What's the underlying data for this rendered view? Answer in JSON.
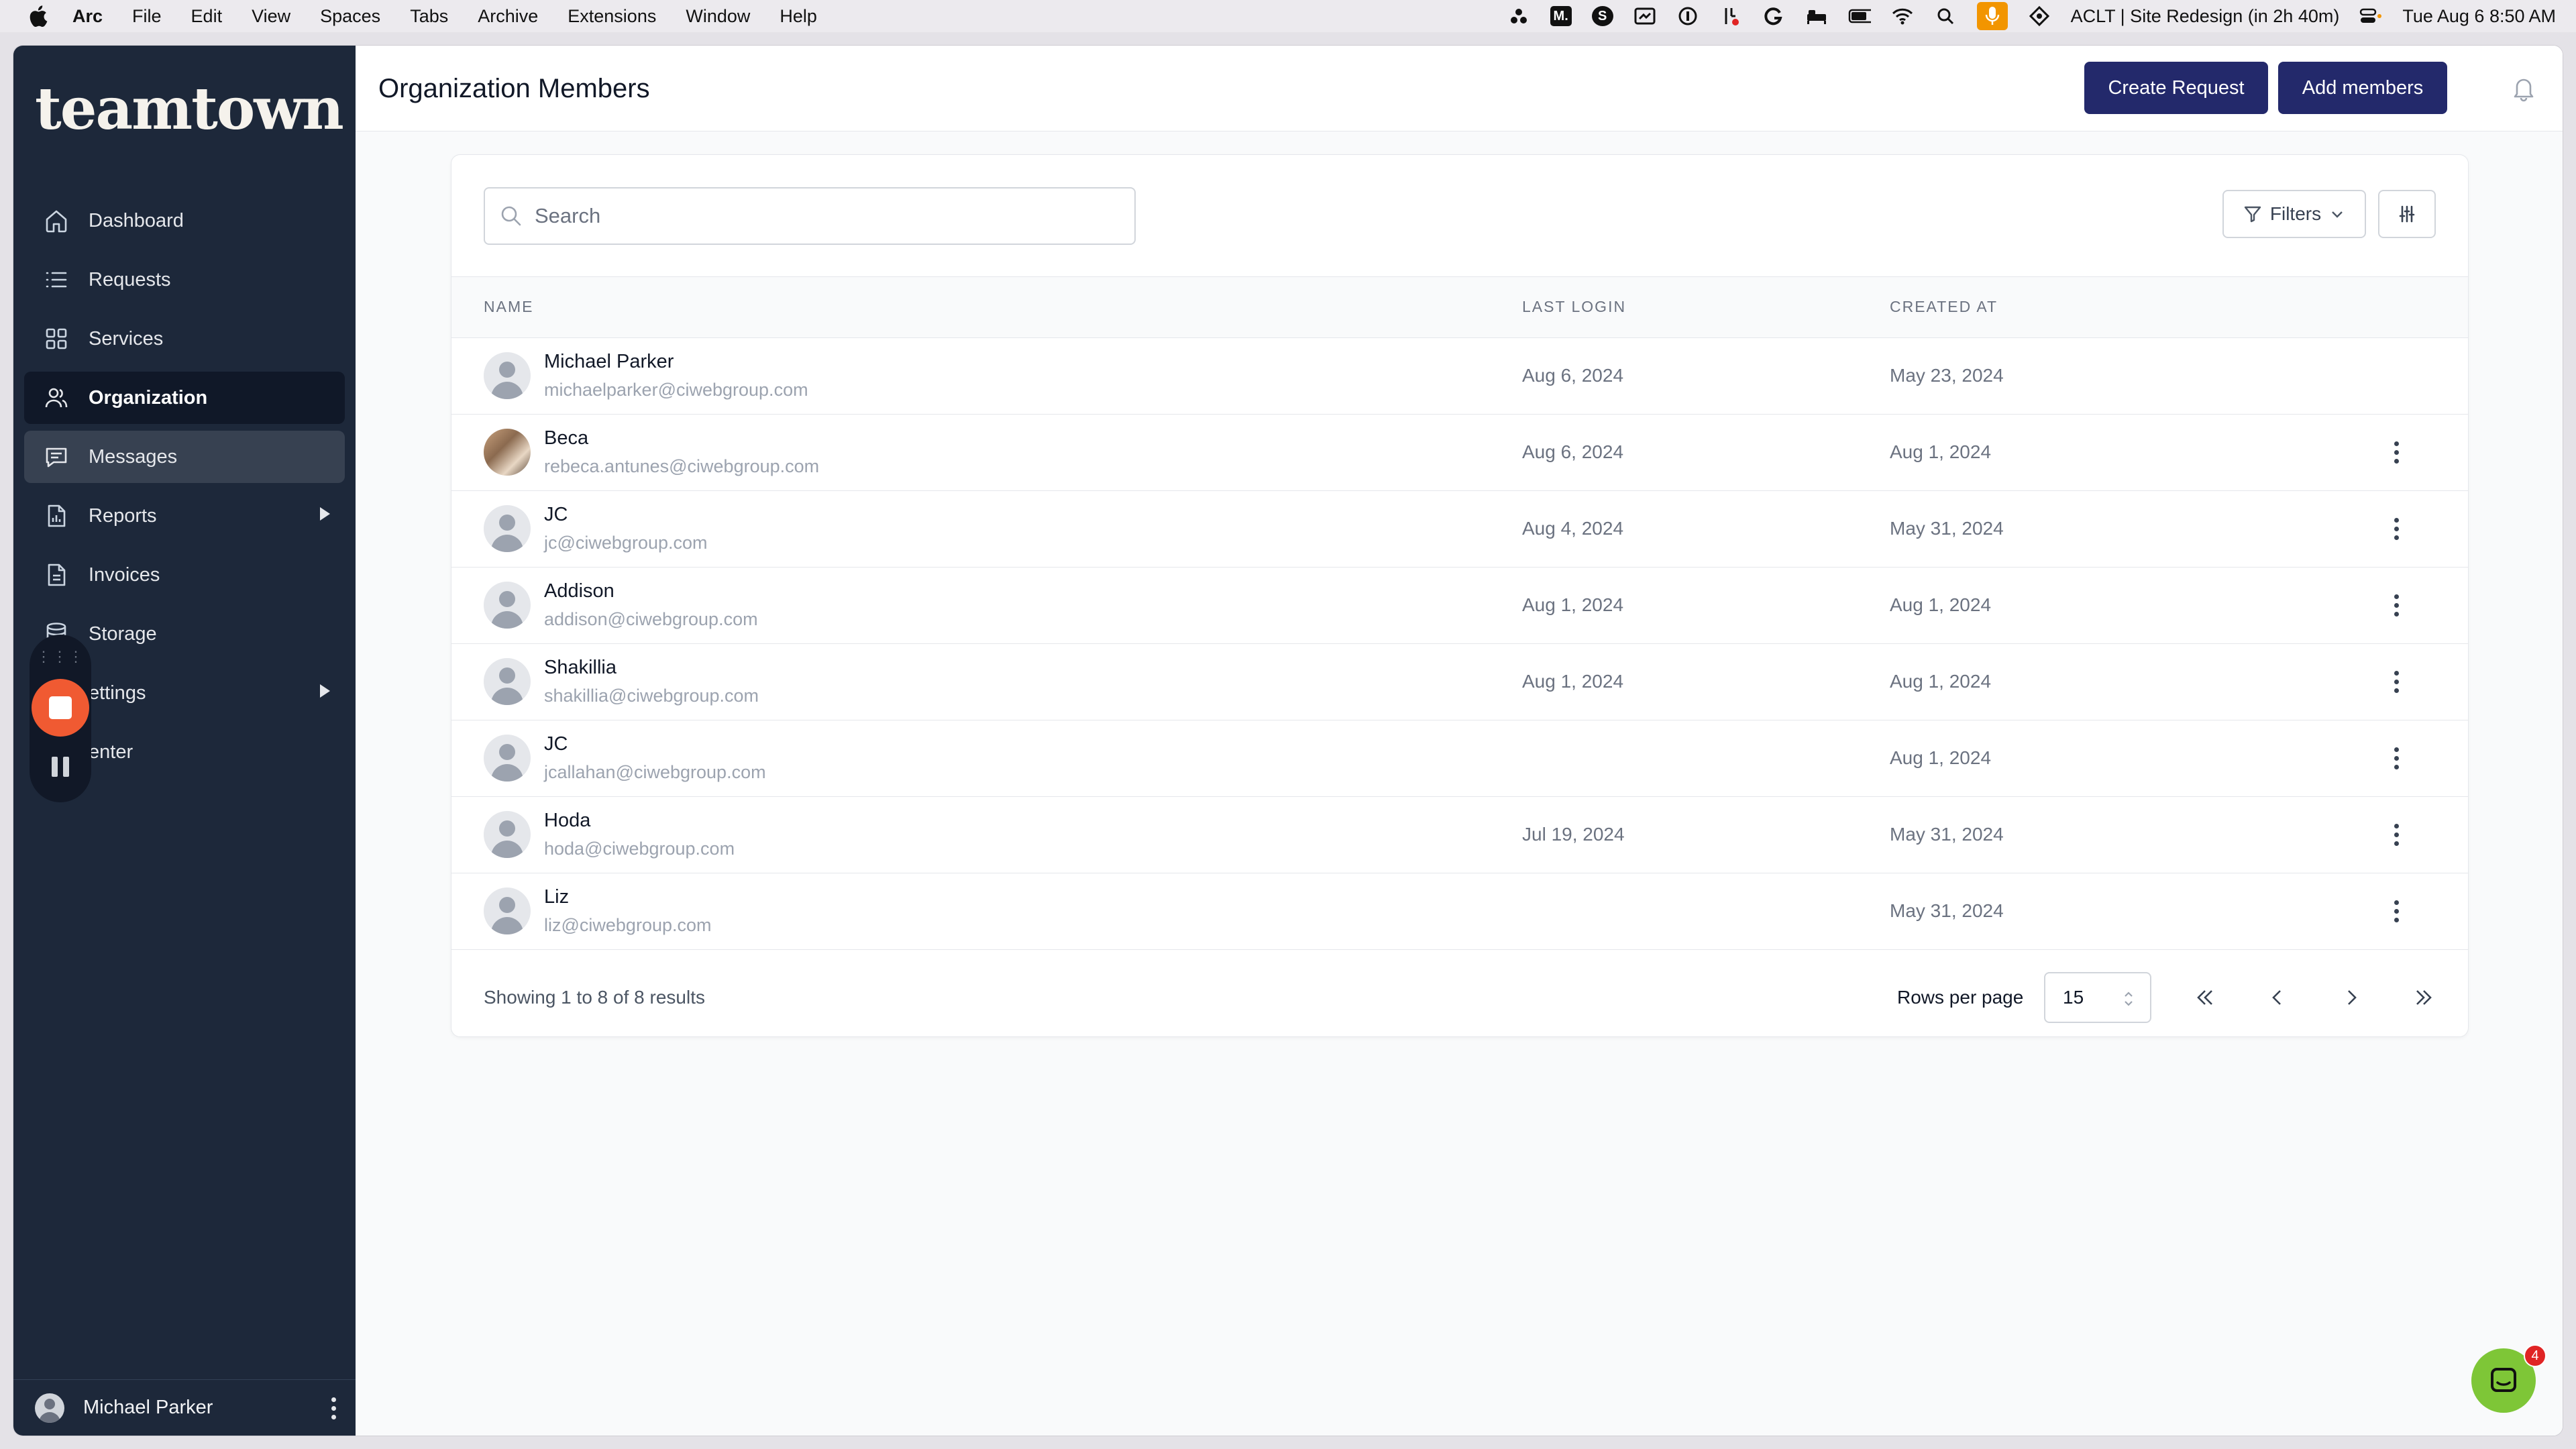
{
  "menubar": {
    "app": "Arc",
    "items": [
      "File",
      "Edit",
      "View",
      "Spaces",
      "Tabs",
      "Archive",
      "Extensions",
      "Window",
      "Help"
    ],
    "status_text": "ACLT | Site Redesign (in 2h 40m)",
    "datetime": "Tue Aug 6  8:50 AM",
    "tray_m": "M.",
    "tray_s": "S"
  },
  "sidebar": {
    "logo": "teamtown",
    "items": [
      {
        "label": "Dashboard",
        "icon": "home-icon"
      },
      {
        "label": "Requests",
        "icon": "list-icon"
      },
      {
        "label": "Services",
        "icon": "grid-icon"
      },
      {
        "label": "Organization",
        "icon": "users-icon",
        "active": true
      },
      {
        "label": "Messages",
        "icon": "message-icon",
        "hover": true
      },
      {
        "label": "Reports",
        "icon": "report-icon",
        "expandable": true
      },
      {
        "label": "Invoices",
        "icon": "invoice-icon"
      },
      {
        "label": "Storage",
        "icon": "database-icon"
      },
      {
        "label": "ettings",
        "icon": "settings-icon",
        "expandable": true
      },
      {
        "label": "enter",
        "icon": "help-icon"
      }
    ],
    "user_name": "Michael Parker"
  },
  "header": {
    "title": "Organization Members",
    "create_request": "Create Request",
    "add_members": "Add members"
  },
  "toolbar": {
    "search_placeholder": "Search",
    "filters_label": "Filters"
  },
  "table": {
    "columns": [
      "NAME",
      "LAST LOGIN",
      "CREATED AT"
    ],
    "rows": [
      {
        "name": "Michael Parker",
        "email": "michaelparker@ciwebgroup.com",
        "last_login": "Aug 6, 2024",
        "created_at": "May 23, 2024",
        "photo": false,
        "menu": false
      },
      {
        "name": "Beca",
        "email": "rebeca.antunes@ciwebgroup.com",
        "last_login": "Aug 6, 2024",
        "created_at": "Aug 1, 2024",
        "photo": true,
        "menu": true
      },
      {
        "name": "JC",
        "email": "jc@ciwebgroup.com",
        "last_login": "Aug 4, 2024",
        "created_at": "May 31, 2024",
        "photo": false,
        "menu": true
      },
      {
        "name": "Addison",
        "email": "addison@ciwebgroup.com",
        "last_login": "Aug 1, 2024",
        "created_at": "Aug 1, 2024",
        "photo": false,
        "menu": true
      },
      {
        "name": "Shakillia",
        "email": "shakillia@ciwebgroup.com",
        "last_login": "Aug 1, 2024",
        "created_at": "Aug 1, 2024",
        "photo": false,
        "menu": true
      },
      {
        "name": "JC",
        "email": "jcallahan@ciwebgroup.com",
        "last_login": "",
        "created_at": "Aug 1, 2024",
        "photo": false,
        "menu": true
      },
      {
        "name": "Hoda",
        "email": "hoda@ciwebgroup.com",
        "last_login": "Jul 19, 2024",
        "created_at": "May 31, 2024",
        "photo": false,
        "menu": true
      },
      {
        "name": "Liz",
        "email": "liz@ciwebgroup.com",
        "last_login": "",
        "created_at": "May 31, 2024",
        "photo": false,
        "menu": true
      }
    ]
  },
  "footer": {
    "showing": "Showing 1 to 8 of 8 results",
    "rows_per_page_label": "Rows per page",
    "rows_per_page_value": "15"
  },
  "chat": {
    "badge": "4"
  },
  "colors": {
    "primary_button": "#23296b",
    "sidebar_bg": "#1d283a",
    "recorder_stop": "#f05a32",
    "chat_fab": "#7ec637"
  }
}
